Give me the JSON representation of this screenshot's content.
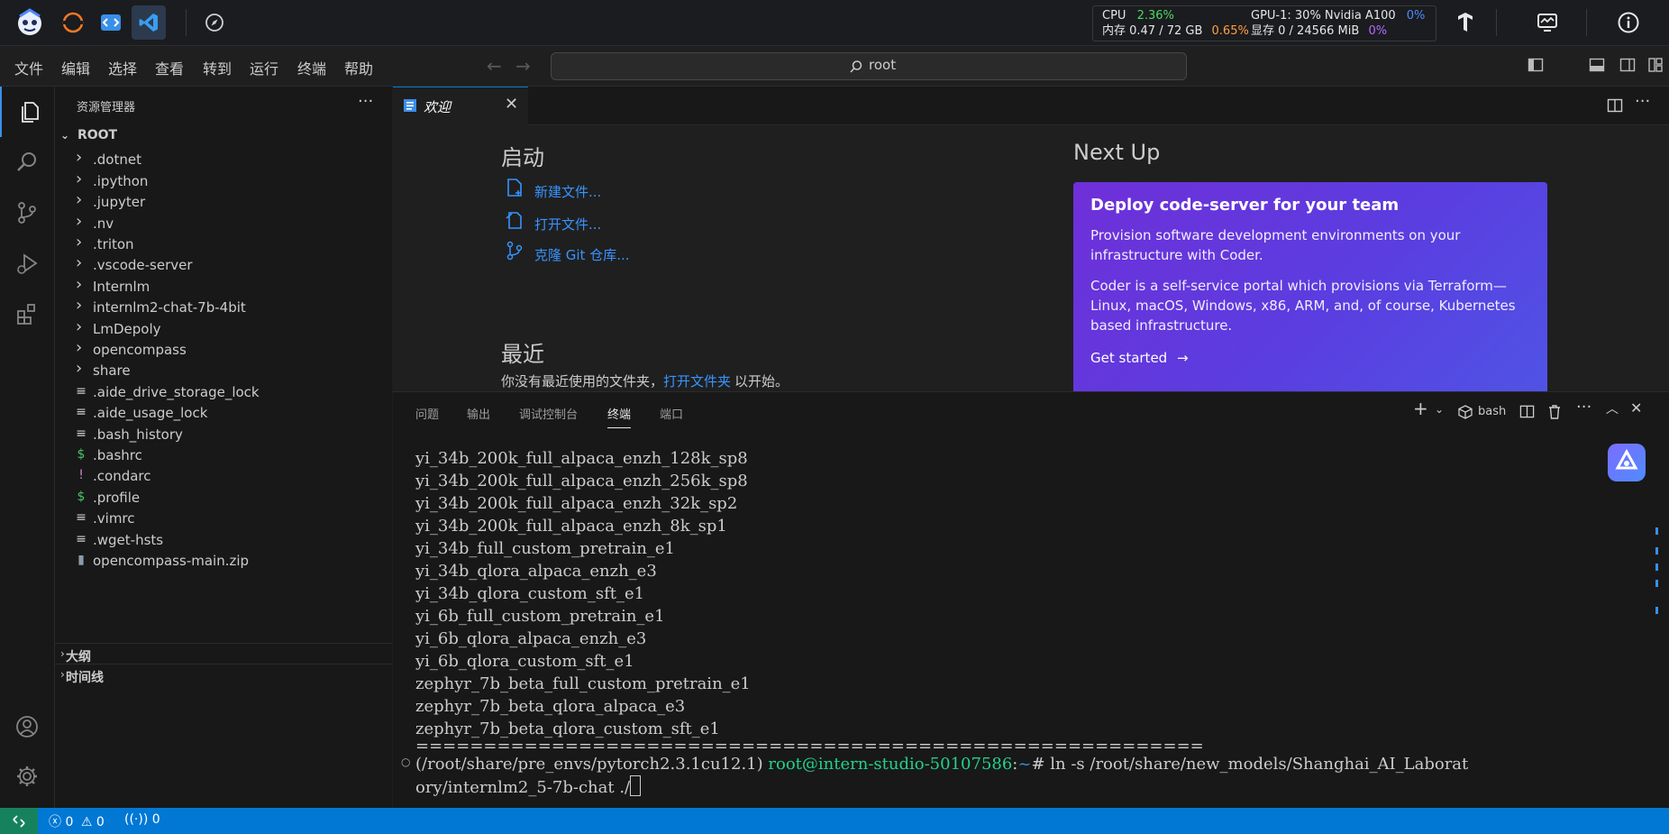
{
  "topbar": {
    "icons": [
      "intern-studio-logo",
      "jupyter-icon",
      "code-editor-icon",
      "vscode-icon",
      "compass-icon"
    ],
    "stats": {
      "cpu_label": "CPU",
      "cpu_value": "2.36%",
      "gpu_label": "GPU-1: 30% Nvidia A100",
      "gpu_value": "0%",
      "mem_label": "内存 0.47 / 72 GB",
      "mem_value": "0.65%",
      "vram_label": "显存 0 / 24566 MiB",
      "vram_value": "0%"
    },
    "colors": {
      "green": "#4cd964",
      "orange": "#ff9f43",
      "blue": "#4b8bff",
      "purple": "#b36cff"
    }
  },
  "menubar": {
    "items": [
      "文件",
      "编辑",
      "选择",
      "查看",
      "转到",
      "运行",
      "终端",
      "帮助"
    ],
    "command_center": "root"
  },
  "sidebar": {
    "title": "资源管理器",
    "root_label": "ROOT",
    "items": [
      {
        "label": ".dotnet",
        "type": "folder"
      },
      {
        "label": ".ipython",
        "type": "folder"
      },
      {
        "label": ".jupyter",
        "type": "folder"
      },
      {
        "label": ".nv",
        "type": "folder"
      },
      {
        "label": ".triton",
        "type": "folder"
      },
      {
        "label": ".vscode-server",
        "type": "folder"
      },
      {
        "label": "Internlm",
        "type": "folder"
      },
      {
        "label": "internlm2-chat-7b-4bit",
        "type": "folder"
      },
      {
        "label": "LmDepoly",
        "type": "folder"
      },
      {
        "label": "opencompass",
        "type": "folder"
      },
      {
        "label": "share",
        "type": "folder"
      },
      {
        "label": ".aide_drive_storage_lock",
        "type": "file"
      },
      {
        "label": ".aide_usage_lock",
        "type": "file"
      },
      {
        "label": ".bash_history",
        "type": "file"
      },
      {
        "label": ".bashrc",
        "type": "shell"
      },
      {
        "label": ".condarc",
        "type": "yaml"
      },
      {
        "label": ".profile",
        "type": "shell"
      },
      {
        "label": ".vimrc",
        "type": "file"
      },
      {
        "label": ".wget-hsts",
        "type": "file"
      },
      {
        "label": "opencompass-main.zip",
        "type": "zip"
      }
    ],
    "outline_label": "大纲",
    "timeline_label": "时间线"
  },
  "editor": {
    "tab_label": "欢迎",
    "start_heading": "启动",
    "new_file": "新建文件...",
    "open_file": "打开文件...",
    "clone_repo": "克隆 Git 仓库...",
    "recent_heading": "最近",
    "recent_text_before": "你没有最近使用的文件夹，",
    "recent_link": "打开文件夹",
    "recent_text_after": "以开始。",
    "next_up": "Next Up",
    "promo": {
      "title": "Deploy code-server for your team",
      "p1": "Provision software development environments on your infrastructure with Coder.",
      "p2": "Coder is a self-service portal which provisions via Terraform—Linux, macOS, Windows, x86, ARM, and, of course, Kubernetes based infrastructure.",
      "cta": "Get started"
    }
  },
  "panel": {
    "tabs": [
      "问题",
      "输出",
      "调试控制台",
      "终端",
      "端口"
    ],
    "active_tab": "终端",
    "shell_label": "bash",
    "terminal_lines": [
      "yi_34b_200k_full_alpaca_enzh_128k_sp8",
      "yi_34b_200k_full_alpaca_enzh_256k_sp8",
      "yi_34b_200k_full_alpaca_enzh_32k_sp2",
      "yi_34b_200k_full_alpaca_enzh_8k_sp1",
      "yi_34b_full_custom_pretrain_e1",
      "yi_34b_qlora_alpaca_enzh_e3",
      "yi_34b_qlora_custom_sft_e1",
      "yi_6b_full_custom_pretrain_e1",
      "yi_6b_qlora_alpaca_enzh_e3",
      "yi_6b_qlora_custom_sft_e1",
      "zephyr_7b_beta_full_custom_pretrain_e1",
      "zephyr_7b_beta_qlora_alpaca_e3",
      "zephyr_7b_beta_qlora_custom_sft_e1",
      "=========================================================="
    ],
    "prompt_env": "(/root/share/pre_envs/pytorch2.3.1cu12.1)",
    "prompt_user": "root@intern-studio-50107586",
    "prompt_sep": ":",
    "prompt_path": "~",
    "prompt_cmd": "# ln -s /root/share/new_models/Shanghai_AI_Laborat",
    "prompt_cmd_cont": "ory/internlm2_5-7b-chat ./"
  },
  "statusbar": {
    "errors": "0",
    "warnings": "0",
    "ports": "0"
  }
}
